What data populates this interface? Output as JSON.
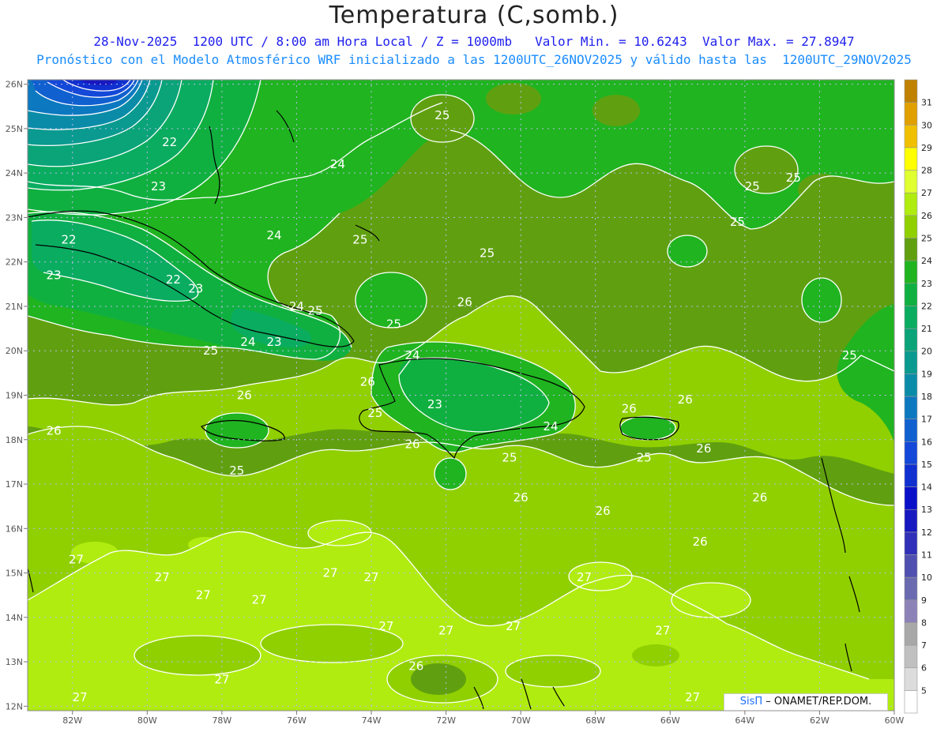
{
  "title": "Temperatura (C,somb.)",
  "subtitle_line1": "28-Nov-2025  1200 UTC / 8:00 am Hora Local / Z = 1000mb   Valor Min. = 10.6243  Valor Max. = 27.8947",
  "subtitle_line2": "Pronóstico con el Modelo Atmosférico WRF inicializado a las 1200UTC_26NOV2025 y válido hasta las  1200UTC_29NOV2025",
  "credit": {
    "brand": "SisΠ",
    "text": " – ONAMET/REP.DOM."
  },
  "map": {
    "lon_range": [
      -83.2,
      -60
    ],
    "lat_range": [
      11.9,
      26.1
    ],
    "lon_ticks": [
      "82W",
      "80W",
      "78W",
      "76W",
      "74W",
      "72W",
      "70W",
      "68W",
      "66W",
      "64W",
      "62W",
      "60W"
    ],
    "lon_values": [
      -82,
      -80,
      -78,
      -76,
      -74,
      -72,
      -70,
      -68,
      -66,
      -64,
      -62,
      -60
    ],
    "lat_ticks": [
      "12N",
      "13N",
      "14N",
      "15N",
      "16N",
      "17N",
      "18N",
      "19N",
      "20N",
      "21N",
      "22N",
      "23N",
      "24N",
      "25N",
      "26N"
    ],
    "lat_values": [
      12,
      13,
      14,
      15,
      16,
      17,
      18,
      19,
      20,
      21,
      22,
      23,
      24,
      25,
      26
    ],
    "grid": "dotted"
  },
  "colorbar": {
    "levels": [
      "5",
      "6",
      "7",
      "8",
      "9",
      "10",
      "11",
      "12",
      "13",
      "14",
      "15",
      "16",
      "17",
      "18",
      "19",
      "20",
      "21",
      "22",
      "23",
      "24",
      "25",
      "26",
      "27",
      "28",
      "29",
      "30",
      "31"
    ],
    "colors": [
      "#ffffff",
      "#dcdcdc",
      "#c0c0c0",
      "#a8a8a8",
      "#8c82b8",
      "#6a6ab0",
      "#5050b0",
      "#3030b8",
      "#1818c0",
      "#0a10c8",
      "#1030d0",
      "#1448d8",
      "#1060d0",
      "#0c78c0",
      "#0a8ca8",
      "#0a9a90",
      "#0aa478",
      "#0aac60",
      "#10b040",
      "#20b420",
      "#60a010",
      "#90d000",
      "#b0ec10",
      "#e0ff30",
      "#ffff00",
      "#f0c000",
      "#e0a000",
      "#c08000"
    ]
  },
  "contour_labels": [
    {
      "t": "25",
      "lon": -72.1,
      "lat": 25.3
    },
    {
      "t": "22",
      "lon": -79.4,
      "lat": 24.7
    },
    {
      "t": "24",
      "lon": -74.9,
      "lat": 24.2
    },
    {
      "t": "23",
      "lon": -79.7,
      "lat": 23.7
    },
    {
      "t": "25",
      "lon": -63.8,
      "lat": 23.7
    },
    {
      "t": "25",
      "lon": -62.7,
      "lat": 23.9
    },
    {
      "t": "24",
      "lon": -76.6,
      "lat": 22.6
    },
    {
      "t": "25",
      "lon": -74.3,
      "lat": 22.5
    },
    {
      "t": "25",
      "lon": -64.2,
      "lat": 22.9
    },
    {
      "t": "22",
      "lon": -82.1,
      "lat": 22.5
    },
    {
      "t": "25",
      "lon": -70.9,
      "lat": 22.2
    },
    {
      "t": "23",
      "lon": -82.5,
      "lat": 21.7
    },
    {
      "t": "22",
      "lon": -79.3,
      "lat": 21.6
    },
    {
      "t": "23",
      "lon": -78.7,
      "lat": 21.4
    },
    {
      "t": "26",
      "lon": -71.5,
      "lat": 21.1
    },
    {
      "t": "24",
      "lon": -76.0,
      "lat": 21.0
    },
    {
      "t": "25",
      "lon": -75.5,
      "lat": 20.9
    },
    {
      "t": "25",
      "lon": -73.4,
      "lat": 20.6
    },
    {
      "t": "24",
      "lon": -77.3,
      "lat": 20.2
    },
    {
      "t": "23",
      "lon": -76.6,
      "lat": 20.2
    },
    {
      "t": "25",
      "lon": -78.3,
      "lat": 20.0
    },
    {
      "t": "24",
      "lon": -72.9,
      "lat": 19.9
    },
    {
      "t": "25",
      "lon": -61.2,
      "lat": 19.9
    },
    {
      "t": "26",
      "lon": -74.1,
      "lat": 19.3
    },
    {
      "t": "26",
      "lon": -77.4,
      "lat": 19.0
    },
    {
      "t": "26",
      "lon": -65.6,
      "lat": 18.9
    },
    {
      "t": "23",
      "lon": -72.3,
      "lat": 18.8
    },
    {
      "t": "26",
      "lon": -67.1,
      "lat": 18.7
    },
    {
      "t": "25",
      "lon": -73.9,
      "lat": 18.6
    },
    {
      "t": "24",
      "lon": -69.2,
      "lat": 18.3
    },
    {
      "t": "26",
      "lon": -82.5,
      "lat": 18.2
    },
    {
      "t": "26",
      "lon": -72.9,
      "lat": 17.9
    },
    {
      "t": "26",
      "lon": -65.1,
      "lat": 17.8
    },
    {
      "t": "25",
      "lon": -70.3,
      "lat": 17.6
    },
    {
      "t": "25",
      "lon": -66.7,
      "lat": 17.6
    },
    {
      "t": "25",
      "lon": -77.6,
      "lat": 17.3
    },
    {
      "t": "26",
      "lon": -70.0,
      "lat": 16.7
    },
    {
      "t": "26",
      "lon": -63.6,
      "lat": 16.7
    },
    {
      "t": "26",
      "lon": -67.8,
      "lat": 16.4
    },
    {
      "t": "26",
      "lon": -65.2,
      "lat": 15.7
    },
    {
      "t": "27",
      "lon": -81.9,
      "lat": 15.3
    },
    {
      "t": "27",
      "lon": -75.1,
      "lat": 15.0
    },
    {
      "t": "27",
      "lon": -74.0,
      "lat": 14.9
    },
    {
      "t": "27",
      "lon": -79.6,
      "lat": 14.9
    },
    {
      "t": "27",
      "lon": -68.3,
      "lat": 14.9
    },
    {
      "t": "27",
      "lon": -78.5,
      "lat": 14.5
    },
    {
      "t": "27",
      "lon": -77.0,
      "lat": 14.4
    },
    {
      "t": "27",
      "lon": -73.6,
      "lat": 13.8
    },
    {
      "t": "27",
      "lon": -72.0,
      "lat": 13.7
    },
    {
      "t": "27",
      "lon": -70.2,
      "lat": 13.8
    },
    {
      "t": "27",
      "lon": -66.2,
      "lat": 13.7
    },
    {
      "t": "26",
      "lon": -72.8,
      "lat": 12.9
    },
    {
      "t": "27",
      "lon": -78.0,
      "lat": 12.6
    },
    {
      "t": "27",
      "lon": -81.8,
      "lat": 12.2
    },
    {
      "t": "27",
      "lon": -65.4,
      "lat": 12.2
    }
  ]
}
